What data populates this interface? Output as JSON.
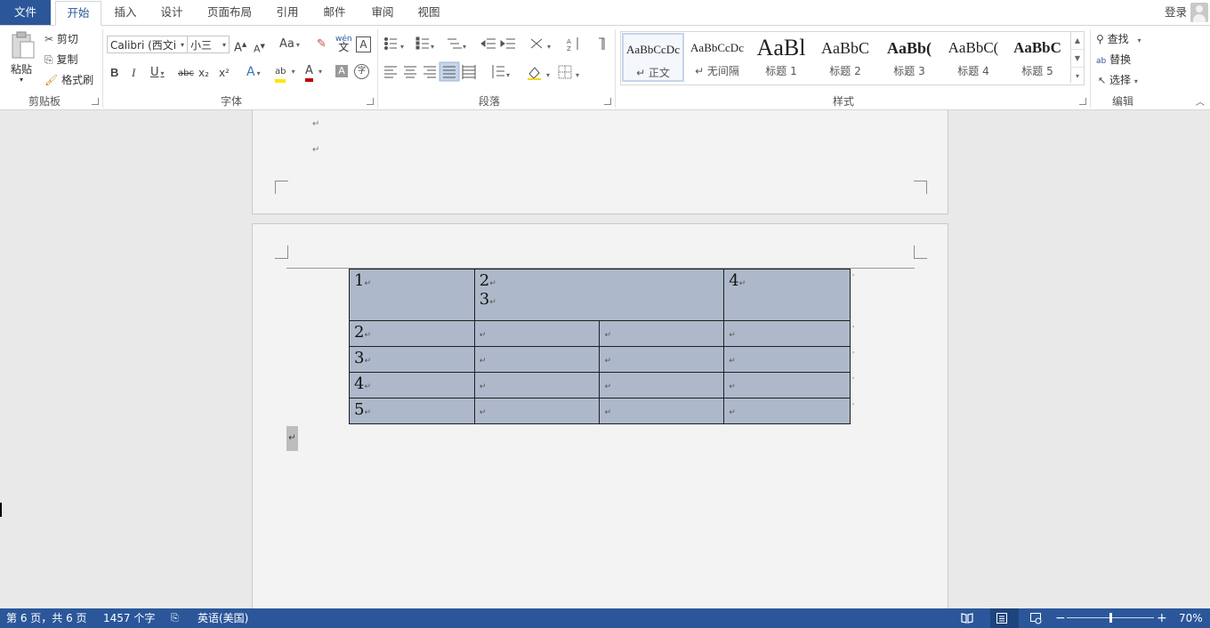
{
  "tabs": {
    "file": "文件",
    "home": "开始",
    "insert": "插入",
    "design": "设计",
    "layout": "页面布局",
    "references": "引用",
    "mailings": "邮件",
    "review": "审阅",
    "view": "视图"
  },
  "account": {
    "login": "登录"
  },
  "clipboard": {
    "paste": "粘贴",
    "cut": "剪切",
    "copy": "复制",
    "format_painter": "格式刷",
    "label": "剪贴板"
  },
  "font": {
    "name": "Calibri (西文i",
    "size": "小三",
    "label": "字体",
    "bold": "B",
    "italic": "I",
    "underline": "U",
    "strike": "abc",
    "sub": "x₂",
    "sup": "x²",
    "grow": "A",
    "shrink": "A",
    "change_case": "Aa",
    "phonetic": "wén",
    "border_char": "A",
    "highlight": "ab",
    "color_a": "A",
    "shade_a": "A",
    "enclose": "字"
  },
  "paragraph": {
    "label": "段落"
  },
  "styles": {
    "label": "样式",
    "items": [
      {
        "sample": "AaBbCcDc",
        "name": "↵ 正文"
      },
      {
        "sample": "AaBbCcDc",
        "name": "↵ 无间隔"
      },
      {
        "sample": "AaBl",
        "name": "标题 1"
      },
      {
        "sample": "AaBbC",
        "name": "标题 2"
      },
      {
        "sample": "AaBb(",
        "name": "标题 3"
      },
      {
        "sample": "AaBbC(",
        "name": "标题 4"
      },
      {
        "sample": "AaBbC",
        "name": "标题 5"
      }
    ]
  },
  "editing": {
    "find": "查找",
    "replace": "替换",
    "select": "选择",
    "label": "编辑"
  },
  "table": {
    "rows": [
      [
        "1",
        "2",
        "3",
        "4"
      ],
      [
        "2"
      ],
      [
        "3"
      ],
      [
        "4"
      ],
      [
        "5"
      ]
    ]
  },
  "status": {
    "page": "第 6 页，共 6 页",
    "words": "1457 个字",
    "language": "英语(美国)",
    "zoom": "70%",
    "zoom_level": 0.5
  }
}
